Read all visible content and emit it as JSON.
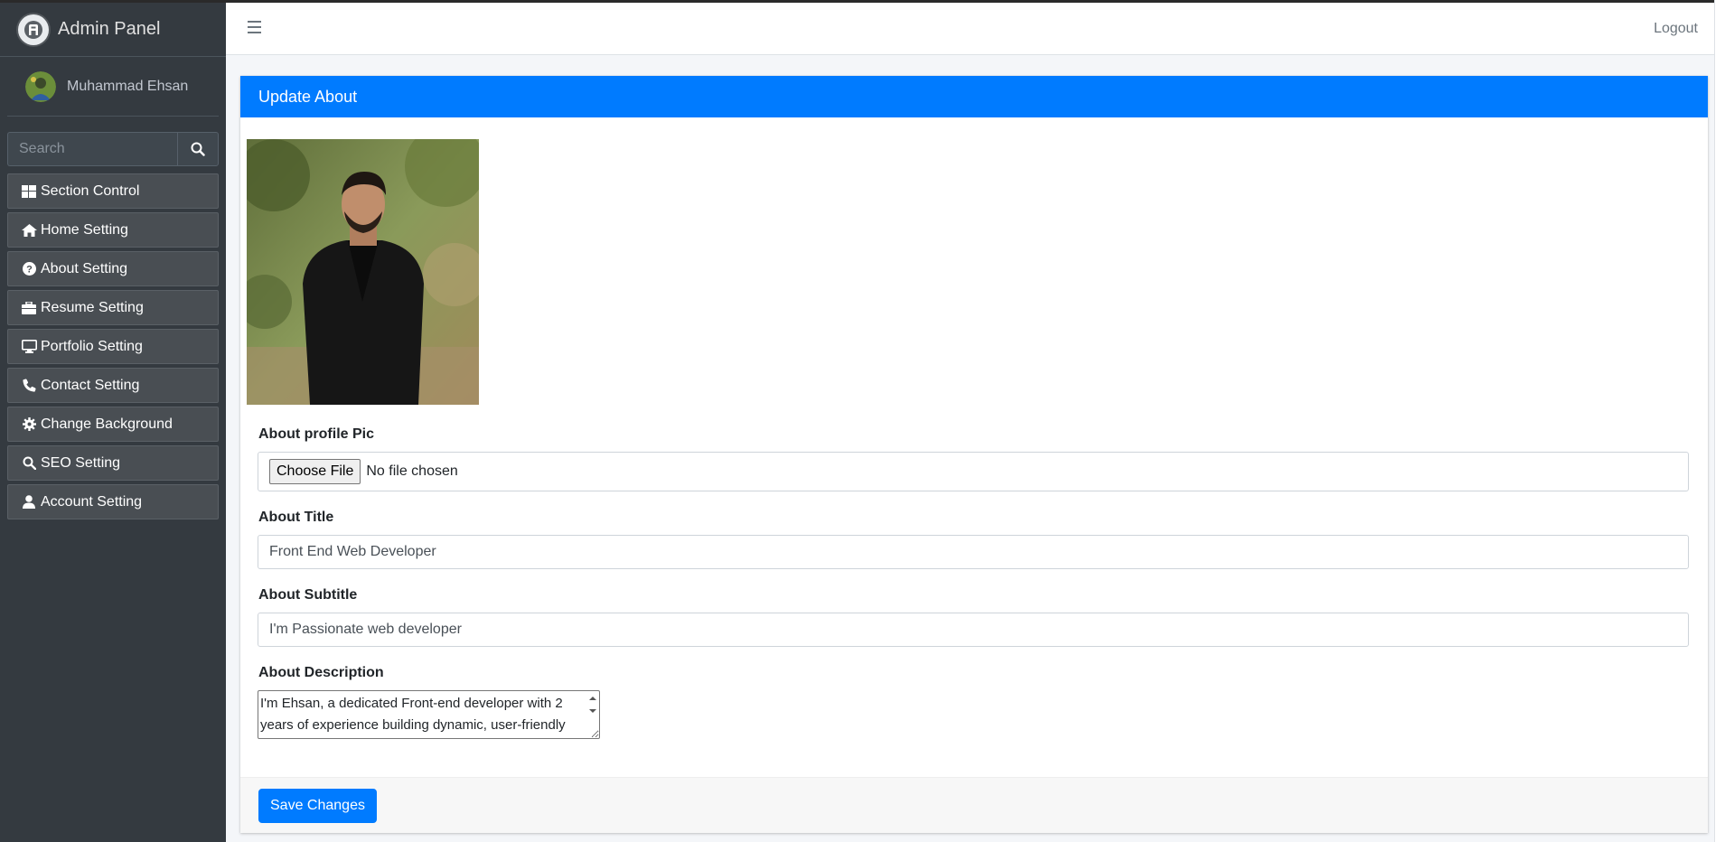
{
  "brand": {
    "title": "Admin Panel"
  },
  "user": {
    "name": "Muhammad Ehsan"
  },
  "search": {
    "placeholder": "Search"
  },
  "sidebar": {
    "items": [
      {
        "label": "Section Control",
        "icon": "grid-icon"
      },
      {
        "label": "Home Setting",
        "icon": "home-icon"
      },
      {
        "label": "About Setting",
        "icon": "question-circle-icon"
      },
      {
        "label": "Resume Setting",
        "icon": "briefcase-icon"
      },
      {
        "label": "Portfolio Setting",
        "icon": "monitor-icon"
      },
      {
        "label": "Contact Setting",
        "icon": "phone-icon"
      },
      {
        "label": "Change Background",
        "icon": "gear-icon"
      },
      {
        "label": "SEO Setting",
        "icon": "search-icon"
      },
      {
        "label": "Account Setting",
        "icon": "user-icon"
      }
    ]
  },
  "header": {
    "logout": "Logout"
  },
  "card": {
    "title": "Update About"
  },
  "form": {
    "pic_label": "About profile Pic",
    "choose_file": "Choose File",
    "no_file": "No file chosen",
    "title_label": "About Title",
    "title_value": "Front End Web Developer",
    "subtitle_label": "About Subtitle",
    "subtitle_value": "I'm Passionate web developer",
    "description_label": "About Description",
    "description_value": "I'm Ehsan, a dedicated Front-end developer with 2 years of experience building dynamic, user-friendly",
    "save": "Save Changes"
  },
  "colors": {
    "primary": "#007bff",
    "sidebar": "#343a40"
  }
}
